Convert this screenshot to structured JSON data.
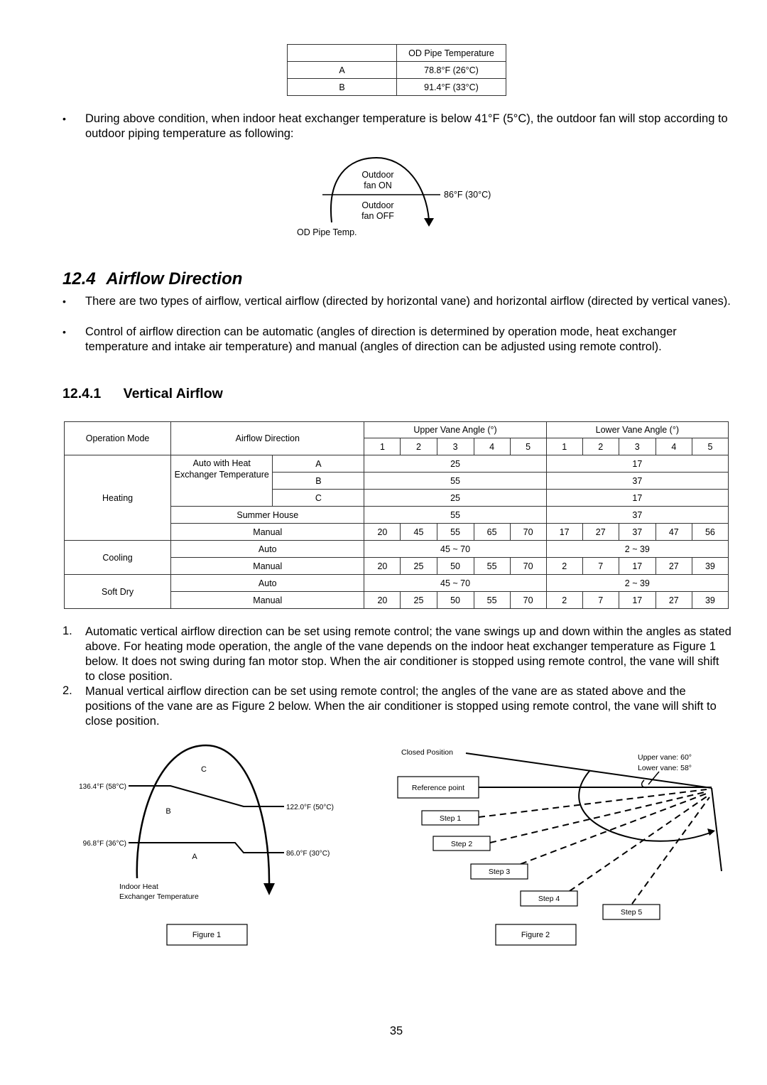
{
  "od_table": {
    "header": [
      "",
      "OD Pipe Temperature"
    ],
    "rows": [
      {
        "label": "A",
        "value": "78.8°F (26°C)"
      },
      {
        "label": "B",
        "value": "91.4°F (33°C)"
      }
    ]
  },
  "bullet_outdoor_fan": "During above condition, when indoor heat exchanger temperature is below 41°F (5°C), the outdoor fan will stop according to outdoor piping temperature as following:",
  "fan_diagram": {
    "on_label_1": "Outdoor",
    "on_label_2": "fan ON",
    "off_label_1": "Outdoor",
    "off_label_2": "fan OFF",
    "threshold": "86°F (30°C)",
    "axis_label": "OD Pipe Temp."
  },
  "section": {
    "number": "12.4",
    "title": "Airflow Direction",
    "bullets": [
      "There are two types of airflow, vertical airflow (directed by horizontal vane) and horizontal airflow (directed by vertical vanes).",
      "Control of airflow direction can be automatic (angles of direction is determined by operation mode, heat exchanger temperature and intake air temperature) and manual (angles of direction can be adjusted using remote control)."
    ]
  },
  "subsection": {
    "number": "12.4.1",
    "title": "Vertical Airflow"
  },
  "vane_table": {
    "headers": {
      "operation_mode": "Operation Mode",
      "airflow_direction": "Airflow Direction",
      "upper": "Upper Vane Angle (°)",
      "lower": "Lower Vane Angle (°)",
      "steps": [
        "1",
        "2",
        "3",
        "4",
        "5"
      ]
    },
    "modes": {
      "heating": "Heating",
      "cooling": "Cooling",
      "soft_dry": "Soft Dry"
    },
    "auto_heat_label": "Auto with Heat Exchanger Temperature",
    "rows": {
      "heat_a": {
        "sub": "A",
        "upper": "25",
        "lower": "17"
      },
      "heat_b": {
        "sub": "B",
        "upper": "55",
        "lower": "37"
      },
      "heat_c": {
        "sub": "C",
        "upper": "25",
        "lower": "17"
      },
      "heat_summer": {
        "label": "Summer House",
        "upper": "55",
        "lower": "37"
      },
      "heat_manual": {
        "label": "Manual",
        "upper": [
          "20",
          "45",
          "55",
          "65",
          "70"
        ],
        "lower": [
          "17",
          "27",
          "37",
          "47",
          "56"
        ]
      },
      "cool_auto": {
        "label": "Auto",
        "upper": "45 ~ 70",
        "lower": "2 ~ 39"
      },
      "cool_manual": {
        "label": "Manual",
        "upper": [
          "20",
          "25",
          "50",
          "55",
          "70"
        ],
        "lower": [
          "2",
          "7",
          "17",
          "27",
          "39"
        ]
      },
      "dry_auto": {
        "label": "Auto",
        "upper": "45 ~ 70",
        "lower": "2 ~ 39"
      },
      "dry_manual": {
        "label": "Manual",
        "upper": [
          "20",
          "25",
          "50",
          "55",
          "70"
        ],
        "lower": [
          "2",
          "7",
          "17",
          "27",
          "39"
        ]
      }
    }
  },
  "notes": [
    {
      "num": "1.",
      "text": "Automatic vertical airflow direction can be set using remote control; the vane swings up and down within the angles as stated above. For heating mode operation, the angle of the vane depends on the indoor heat exchanger temperature as Figure 1 below. It does not swing during fan motor stop. When the air conditioner is stopped using remote control, the vane will shift to close position."
    },
    {
      "num": "2.",
      "text": "Manual vertical airflow direction can be set using remote control; the angles of the vane are as stated above and the positions of the vane are as Figure 2 below. When the air conditioner is stopped using remote control, the vane will shift to close position."
    }
  ],
  "figure1": {
    "zone_c": "C",
    "zone_b": "B",
    "zone_a": "A",
    "t_136": "136.4°F (58°C)",
    "t_122": "122.0°F (50°C)",
    "t_96": "96.8°F (36°C)",
    "t_86": "86.0°F (30°C)",
    "axis_label_1": "Indoor Heat",
    "axis_label_2": "Exchanger Temperature",
    "caption": "Figure 1"
  },
  "figure2": {
    "closed_position": "Closed Position",
    "upper_vane": "Upper vane: 60°",
    "lower_vane": "Lower vane: 58°",
    "reference_point": "Reference point",
    "steps": [
      "Step 1",
      "Step 2",
      "Step 3",
      "Step 4",
      "Step 5"
    ],
    "caption": "Figure 2"
  },
  "page_number": "35"
}
